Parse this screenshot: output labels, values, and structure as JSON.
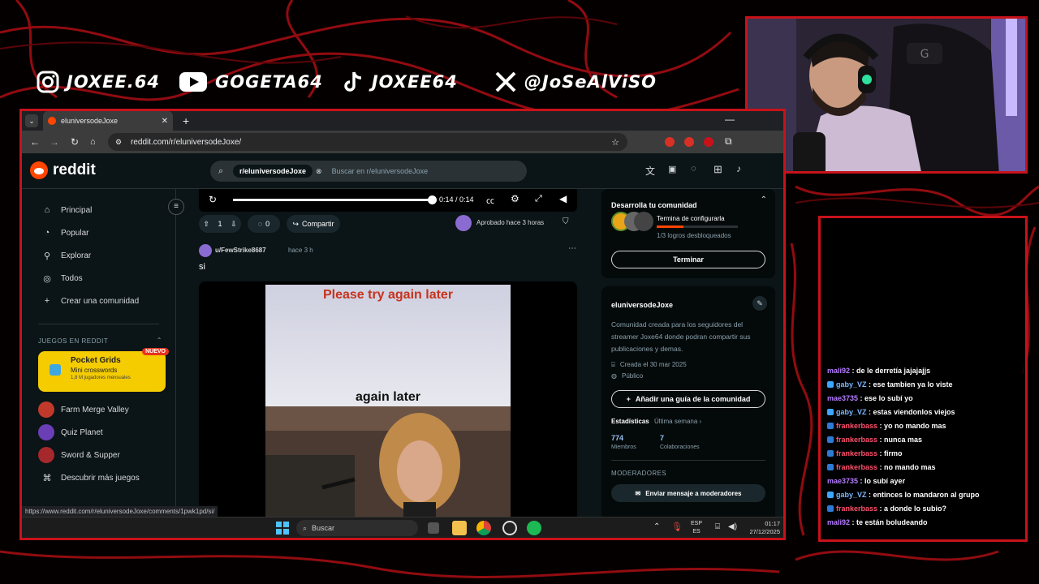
{
  "overlay": {
    "socials": [
      {
        "icon": "instagram-icon",
        "handle": "JOXEE.64"
      },
      {
        "icon": "youtube-icon",
        "handle": "GOGETA64"
      },
      {
        "icon": "tiktok-icon",
        "handle": "JOXEE64"
      },
      {
        "icon": "x-icon",
        "handle": "@JoSeAlViSO"
      }
    ],
    "accent_color": "#c8121a"
  },
  "browser": {
    "tab_title": "eluniversodeJoxe",
    "url": "reddit.com/r/eluniversodeJoxe/",
    "status_url": "https://www.reddit.com/r/eluniversodeJoxe/comments/1pwk1pd/si/"
  },
  "reddit": {
    "logo_text": "reddit",
    "search_chip": "r/eluniversodeJoxe",
    "search_placeholder": "Buscar en r/eluniversodeJoxe",
    "nav": [
      {
        "icon": "home-icon",
        "label": "Principal"
      },
      {
        "icon": "popular-icon",
        "label": "Popular"
      },
      {
        "icon": "explore-icon",
        "label": "Explorar"
      },
      {
        "icon": "all-icon",
        "label": "Todos"
      },
      {
        "icon": "plus-icon",
        "label": "Crear una comunidad"
      }
    ],
    "games_heading": "JUEGOS EN REDDIT",
    "featured_game": {
      "title": "Pocket Grids",
      "subtitle": "Mini crosswords",
      "players": "1,8 M jugadores mensuales",
      "badge": "NUEVO"
    },
    "games": [
      "Farm Merge Valley",
      "Quiz Planet",
      "Sword & Supper",
      "Descubrir más juegos"
    ],
    "video": {
      "time": "0:14 / 0:14",
      "progress": 1.0
    },
    "post_actions": {
      "votes": "1",
      "comments": "0",
      "share": "Compartir",
      "approved": "Aprobado hace 3 horas"
    },
    "comment": {
      "author": "u/FewStrike8687",
      "time": "hace 3 h",
      "text": "si"
    },
    "meme": {
      "top_text": "Please try again later",
      "bottom_text": "again later"
    },
    "community_card": {
      "title": "Desarrolla tu comunidad",
      "task": "Termina de configurarla",
      "progress_text": "1/3 logros desbloqueados",
      "progress": 0.33,
      "button": "Terminar"
    },
    "about": {
      "name": "eluniversodeJoxe",
      "description": "Comunidad creada para los seguidores del streamer Joxe64 donde podran compartir sus publicaciones y demas.",
      "created": "Creada el 30 mar 2025",
      "visibility": "Público",
      "guide_button": "Añadir una guía de la comunidad",
      "stats_label": "Estadísticas",
      "stats_period": "Última semana",
      "members_value": "774",
      "members_label": "Miembros",
      "contrib_value": "7",
      "contrib_label": "Colaboraciones",
      "mods_heading": "MODERADORES",
      "mods_button": "Enviar mensaje a moderadores"
    }
  },
  "taskbar": {
    "search": "Buscar",
    "lang_top": "ESP",
    "lang_bottom": "ES",
    "time": "01:17",
    "date": "27/12/2025"
  },
  "chat": [
    {
      "user": "mali92",
      "color": "#b57bff",
      "badge": "",
      "msg": "de le derretía jajajajjs"
    },
    {
      "user": "gaby_VZ",
      "color": "#7ab7ff",
      "badge": "#3ea6ff",
      "msg": "ese tambien ya lo viste"
    },
    {
      "user": "mae3735",
      "color": "#b57bff",
      "badge": "",
      "msg": "ese lo subí yo"
    },
    {
      "user": "gaby_VZ",
      "color": "#7ab7ff",
      "badge": "#3ea6ff",
      "msg": "estas viendonlos viejos"
    },
    {
      "user": "frankerbass",
      "color": "#ff4f6d",
      "badge": "#2e7bd6",
      "msg": "yo no mando mas"
    },
    {
      "user": "frankerbass",
      "color": "#ff4f6d",
      "badge": "#2e7bd6",
      "msg": "nunca mas"
    },
    {
      "user": "frankerbass",
      "color": "#ff4f6d",
      "badge": "#2e7bd6",
      "msg": "firmo"
    },
    {
      "user": "frankerbass",
      "color": "#ff4f6d",
      "badge": "#2e7bd6",
      "msg": "no mando mas"
    },
    {
      "user": "mae3735",
      "color": "#b57bff",
      "badge": "",
      "msg": "lo subí ayer"
    },
    {
      "user": "gaby_VZ",
      "color": "#7ab7ff",
      "badge": "#3ea6ff",
      "msg": "entinces lo mandaron al grupo"
    },
    {
      "user": "frankerbass",
      "color": "#ff4f6d",
      "badge": "#2e7bd6",
      "msg": "a donde lo subio?"
    },
    {
      "user": "mali92",
      "color": "#b57bff",
      "badge": "",
      "msg": "te están boludeando"
    }
  ]
}
